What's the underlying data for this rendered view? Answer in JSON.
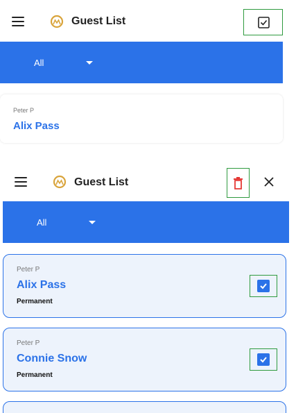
{
  "top_screen": {
    "app_title": "Guest List",
    "select_mode_icon": "checkbox-icon",
    "filter": {
      "selected": "All"
    },
    "partial_card": {
      "host": "Peter P",
      "guest_name": "Alix Pass"
    }
  },
  "bottom_screen": {
    "app_title": "Guest List",
    "delete_icon": "trash-icon",
    "close_icon": "close-icon",
    "filter": {
      "selected": "All"
    },
    "guests": [
      {
        "host": "Peter P",
        "guest_name": "Alix Pass",
        "type": "Permanent",
        "selected": true
      },
      {
        "host": "Peter P",
        "guest_name": "Connie Snow",
        "type": "Permanent",
        "selected": true
      }
    ]
  },
  "colors": {
    "primary": "#2b72e8",
    "highlight": "#2e9a3e",
    "delete": "#e53935",
    "logo": "#d9a43b"
  }
}
